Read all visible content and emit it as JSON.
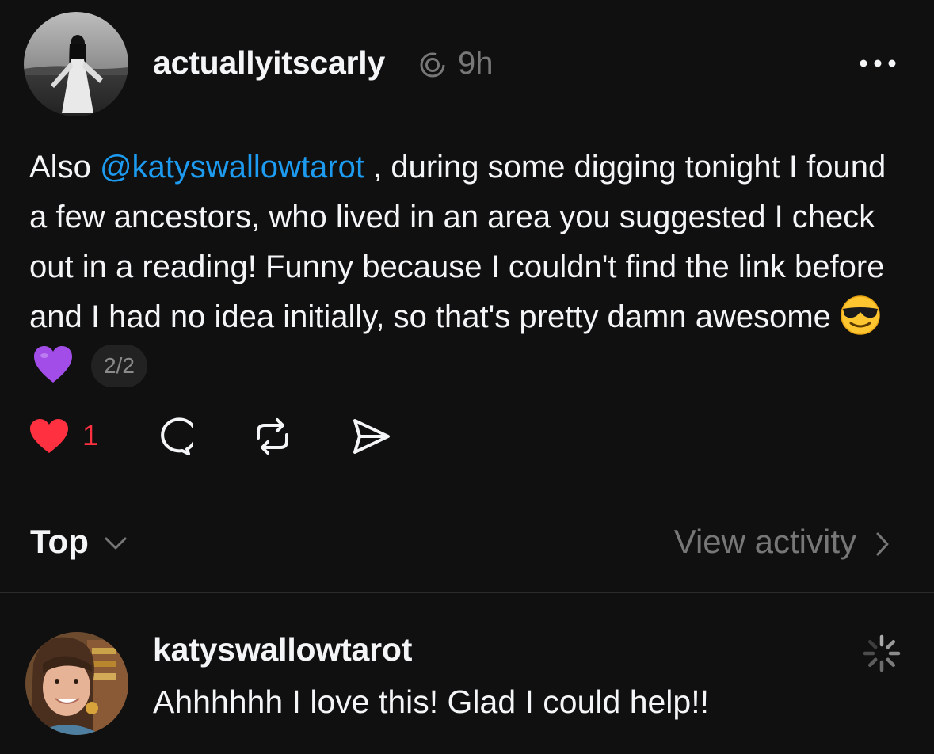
{
  "post": {
    "username": "actuallyitscarly",
    "timestamp": "9h",
    "mention": "@katyswallowtarot",
    "text_before_mention": "Also ",
    "text_after_mention": " , during some digging tonight I found a few ancestors, who lived in an area you suggested I check out in a reading! Funny because I couldn't find the link before and I had no idea initially, so that's pretty damn awesome ",
    "emojis": [
      "smiling-face-with-sunglasses",
      "purple-heart"
    ],
    "page_indicator": "2/2",
    "like_count": "1",
    "liked": true
  },
  "sort": {
    "label": "Top"
  },
  "activity": {
    "label": "View activity"
  },
  "reply": {
    "username": "katyswallowtarot",
    "text": "Ahhhhhh I love this! Glad I could help!!"
  },
  "colors": {
    "background": "#101010",
    "text_primary": "#f3f5f7",
    "text_secondary": "#777777",
    "mention": "#1d9bf0",
    "like": "#ff3040"
  }
}
